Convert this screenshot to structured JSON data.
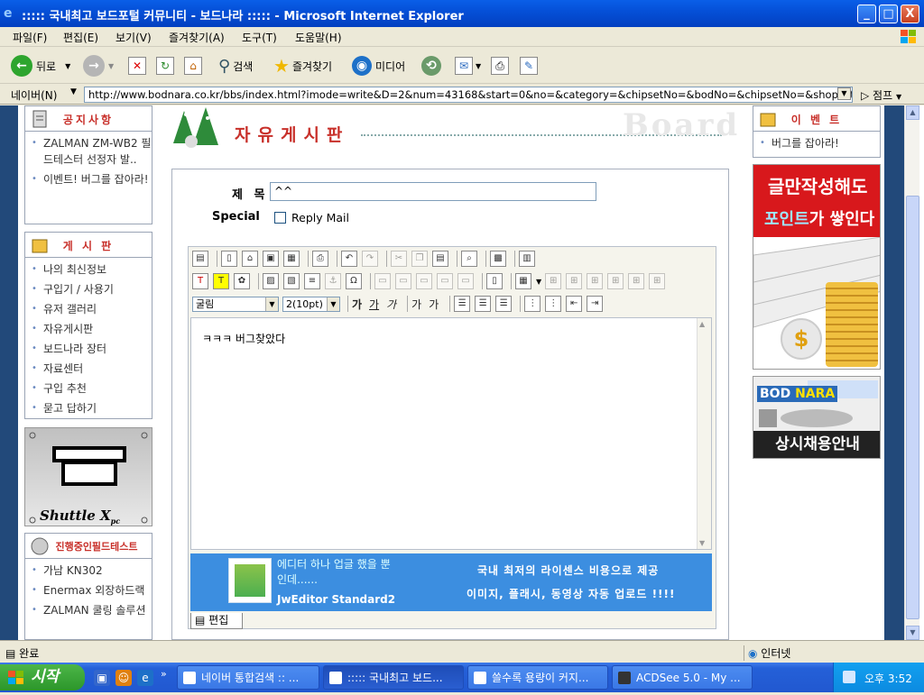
{
  "window": {
    "title": "::::: 국내최고 보드포털 커뮤니티 - 보드나라 ::::: - Microsoft Internet Explorer",
    "min_label": "_",
    "max_label": "□",
    "close_label": "X"
  },
  "menu": {
    "items": [
      "파일(F)",
      "편집(E)",
      "보기(V)",
      "즐겨찾기(A)",
      "도구(T)",
      "도움말(H)"
    ]
  },
  "toolbar": {
    "back_label": "뒤로",
    "search_label": "검색",
    "favorites_label": "즐겨찾기",
    "media_label": "미디어"
  },
  "address": {
    "label": "네이버(N)",
    "url": "http://www.bodnara.co.kr/bbs/index.html?imode=write&D=2&num=43168&start=0&no=&category=&chipsetNo=&bodNo=&chipsetNo=&shopcategory=",
    "jump_label": "점프"
  },
  "left": {
    "notice": {
      "title": "공지사항",
      "items": [
        "ZALMAN ZM-WB2 필드테스터 선정자 발..",
        "이벤트! 버그를 잡아라!"
      ]
    },
    "board": {
      "title": "게 시 판",
      "items": [
        "나의 최신정보",
        "구입기 / 사용기",
        "유저 갤러리",
        "자유게시판",
        "보드나라 장터",
        "자료센터",
        "구입 추천",
        "묻고 답하기"
      ]
    },
    "shuttle_label": "Shuttle X",
    "shuttle_suffix": "pc",
    "fieldtest": {
      "title": "진행중인필드테스트",
      "items": [
        "가남 KN302",
        "Enermax 외장하드랙",
        "ZALMAN 쿨링 솔루션"
      ]
    }
  },
  "main": {
    "board_title": "자유게시판",
    "board_watermark": "Board",
    "form": {
      "title_label": "제 목",
      "title_value": "^^",
      "special_label": "Special",
      "reply_mail_label": "Reply Mail",
      "font_select": "굴림",
      "size_select": "2(10pt)",
      "format_buttons": [
        "가",
        "가",
        "가",
        "가",
        "가"
      ],
      "body_text": "ㅋㅋㅋ 버그찾았다",
      "edit_tab_label": "편집"
    },
    "banner": {
      "line1": "에디터 하나 업글 했을 뿐인데......",
      "product": "JwEditor Standard2",
      "line3": "국내 최저의 라이센스 비용으로 제공",
      "line4": "이미지, 플래시, 동영상 자동 업로드 !!!!"
    }
  },
  "right": {
    "event": {
      "title": "이 벤 트",
      "items": [
        "버그를 잡아라!"
      ]
    },
    "ad1": {
      "line1": "글만작성해도",
      "line2_highlight": "포인트",
      "line2_rest": "가 쌓인다",
      "coin_symbol": "$"
    },
    "ad2": {
      "logo_a": "BOD",
      "logo_b": "NARA",
      "bottom_text": "상시채용안내"
    }
  },
  "status": {
    "left": "완료",
    "zone": "인터넷"
  },
  "taskbar": {
    "start_label": "시작",
    "tasks": [
      "네이버 통합검색 :: ...",
      "::::: 국내최고 보드...",
      "쓸수록 용량이 커지...",
      "ACDSee 5.0 - My ..."
    ],
    "clock": "오후 3:52"
  },
  "colors": {
    "titlebar": "#0A5FE8",
    "accent_red": "#C8302A",
    "side_navy": "#22497A",
    "banner_blue": "#3C8EE0"
  }
}
